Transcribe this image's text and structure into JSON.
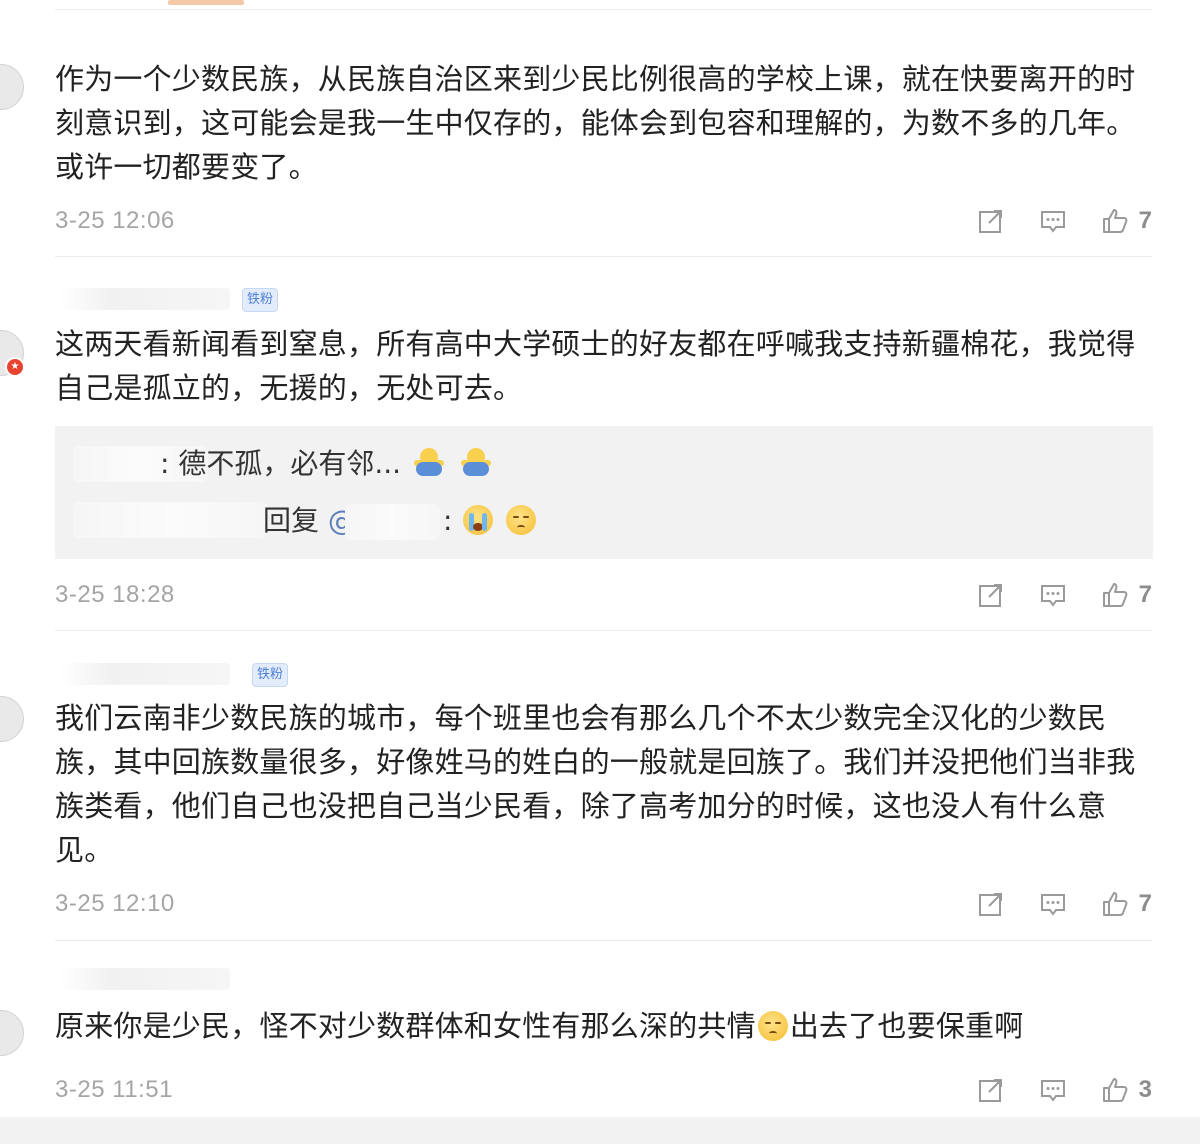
{
  "comments": [
    {
      "text": "作为一个少数民族，从民族自治区来到少民比例很高的学校上课，就在快要离开的时刻意识到，这可能会是我一生中仅存的，能体会到包容和理解的，为数不多的几年。或许一切都要变了。",
      "time": "3-25 12:06",
      "likes": "7"
    },
    {
      "badge": "铁粉",
      "text": "这两天看新闻看到窒息，所有高中大学硕士的好友都在呼喊我支持新疆棉花，我觉得自己是孤立的，无援的，无处可去。",
      "replies": [
        {
          "prefix": ":",
          "text": "德不孤，必有邻...",
          "emojis": [
            "hug-emoji",
            "hug-emoji"
          ]
        },
        {
          "text": "回复",
          "mention": "@",
          "suffix": ":",
          "emojis": [
            "crying-emoji",
            "pensive-emoji"
          ]
        }
      ],
      "time": "3-25 18:28",
      "likes": "7"
    },
    {
      "badge": "铁粉",
      "text": "我们云南非少数民族的城市，每个班里也会有那么几个不太少数完全汉化的少数民族，其中回族数量很多，好像姓马的姓白的一般就是回族了。我们并没把他们当非我族类看，他们自己也没把自己当少民看，除了高考加分的时候，这也没人有什么意见。",
      "time": "3-25 12:10",
      "likes": "7"
    },
    {
      "text_before": "原来你是少民，怪不对少数群体和女性有那么深的共情",
      "emoji": "pensive-emoji",
      "text_after": "出去了也要保重啊",
      "time": "3-25 11:51",
      "likes": "3"
    }
  ],
  "icons": {
    "repost": "repost-icon",
    "comment": "comment-icon",
    "like": "thumbs-up-icon",
    "verified": "verified-badge-icon"
  },
  "colors": {
    "text": "#222222",
    "meta": "#a5a5a5",
    "badge_bg": "#e3ecfa",
    "badge_text": "#4e7fd6",
    "reply_bg": "#f2f2f2",
    "mention": "#5b7fb8",
    "verified": "#e8432f"
  }
}
